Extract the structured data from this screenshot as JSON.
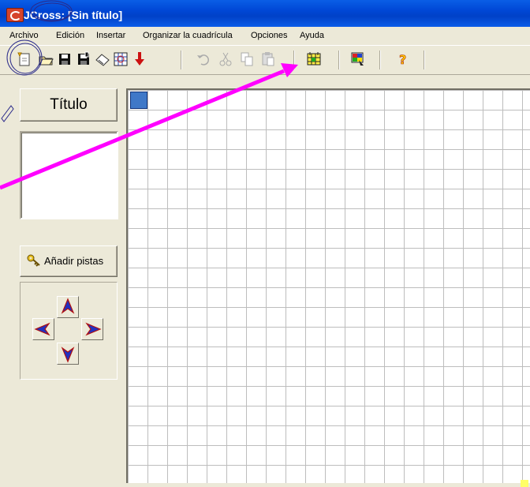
{
  "window": {
    "title": "JCross: [Sin título]"
  },
  "menu": {
    "items": [
      "Archivo",
      "Edición",
      "Insertar",
      "Organizar la cuadrícula",
      "Opciones",
      "Ayuda"
    ]
  },
  "toolbar": {
    "buttons": [
      "new-icon",
      "open-icon",
      "save-icon",
      "save-as-icon",
      "erase-icon",
      "grid-web-icon",
      "export-arrow-icon",
      "undo-icon",
      "cut-icon",
      "copy-icon",
      "paste-icon",
      "auto-grid-icon",
      "config-icon",
      "help-icon"
    ]
  },
  "panel": {
    "title_button": "Título",
    "title_value": "",
    "clues_button": "Añadir pistas"
  },
  "grid": {
    "cols": 20,
    "rows": 20,
    "selected_row": 1,
    "selected_col": 1
  },
  "colors": {
    "titlebar": "#0047d5",
    "annotation": "#ff00ff",
    "selected_cell": "#3f78c8"
  }
}
